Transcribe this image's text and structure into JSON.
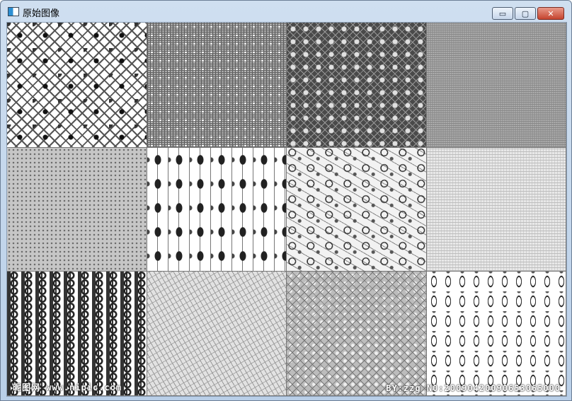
{
  "window": {
    "title": "原始图像",
    "icon": "app-image-icon",
    "controls": {
      "minimize": "▭",
      "maximize": "▢",
      "close": "✕"
    }
  },
  "image": {
    "rows": 3,
    "cols": 4,
    "tiles": [
      {
        "name": "pattern-tile-1",
        "style": "t1"
      },
      {
        "name": "pattern-tile-2",
        "style": "t2"
      },
      {
        "name": "pattern-tile-3",
        "style": "t3"
      },
      {
        "name": "pattern-tile-4",
        "style": "t4"
      },
      {
        "name": "pattern-tile-5",
        "style": "t5"
      },
      {
        "name": "pattern-tile-6",
        "style": "t6"
      },
      {
        "name": "pattern-tile-7",
        "style": "t7"
      },
      {
        "name": "pattern-tile-8",
        "style": "t8"
      },
      {
        "name": "pattern-tile-9",
        "style": "t9"
      },
      {
        "name": "pattern-tile-10",
        "style": "t10"
      },
      {
        "name": "pattern-tile-11",
        "style": "t11"
      },
      {
        "name": "pattern-tile-12",
        "style": "t12"
      }
    ],
    "watermark_left": "昵图网 www.nipic.com",
    "watermark_right": "BY:zzg N0:20090420090653065000"
  }
}
